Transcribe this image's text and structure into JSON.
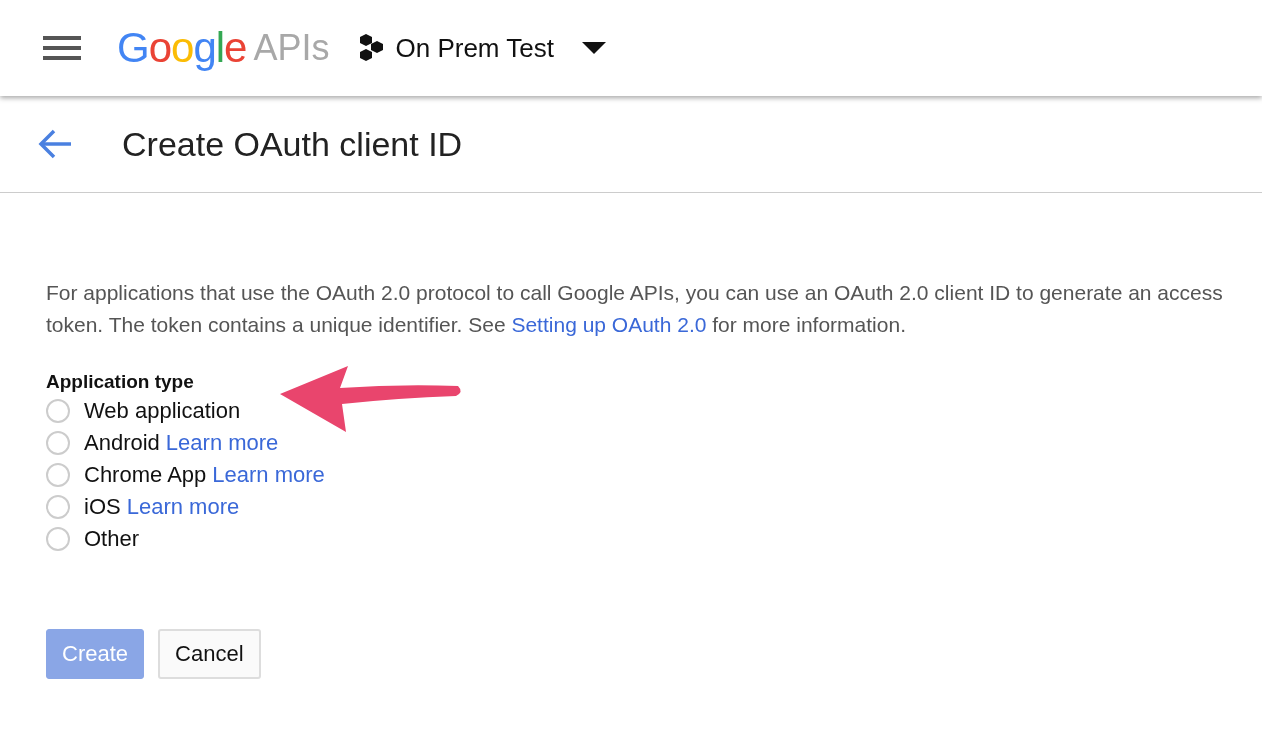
{
  "header": {
    "logo": "Google",
    "product": "APIs",
    "project": "On Prem Test"
  },
  "page": {
    "title": "Create OAuth client ID"
  },
  "description": {
    "before": "For applications that use the OAuth 2.0 protocol to call Google APIs, you can use an OAuth 2.0 client ID to generate an access token. The token contains a unique identifier. See ",
    "link": "Setting up OAuth 2.0",
    "after": " for more information."
  },
  "application_type": {
    "label": "Application type",
    "options": [
      {
        "label": "Web application",
        "selected": false
      },
      {
        "label": "Android",
        "link": "Learn more",
        "selected": false
      },
      {
        "label": "Chrome App",
        "link": "Learn more",
        "selected": false
      },
      {
        "label": "iOS",
        "link": "Learn more",
        "selected": false
      },
      {
        "label": "Other",
        "selected": false
      }
    ]
  },
  "buttons": [
    {
      "label": "Create",
      "kind": "primary",
      "disabled": true
    },
    {
      "label": "Cancel",
      "kind": "secondary",
      "disabled": false
    }
  ]
}
